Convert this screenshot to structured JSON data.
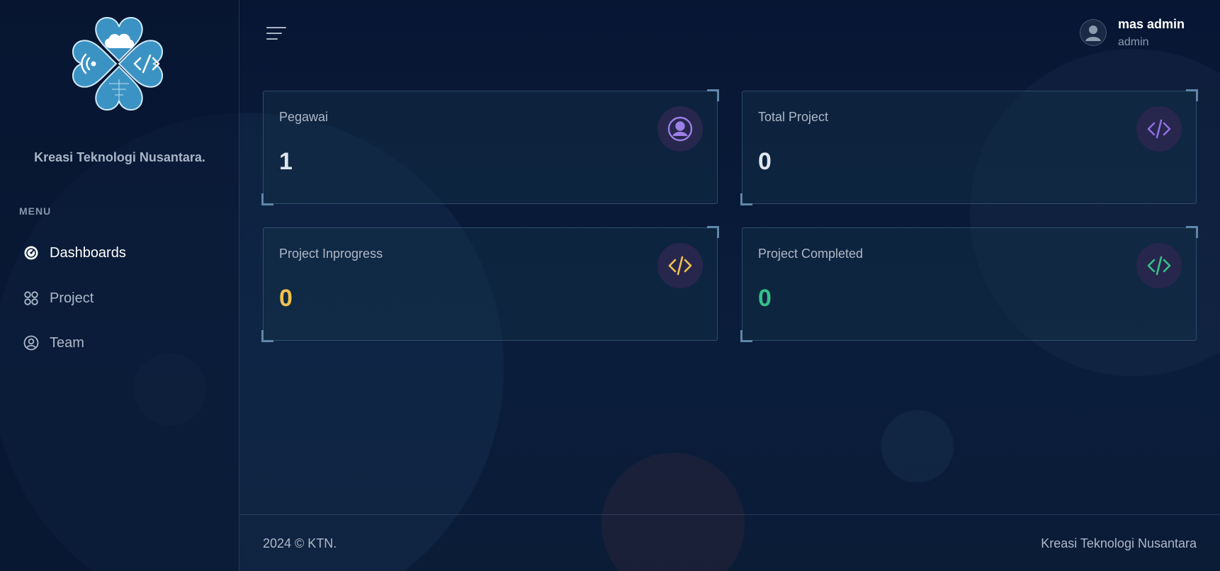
{
  "sidebar": {
    "brand": "Kreasi Teknologi Nusantara.",
    "menu_title": "MENU",
    "items": [
      {
        "label": "Dashboards",
        "icon": "dashboard-gauge-icon",
        "active": true
      },
      {
        "label": "Project",
        "icon": "grid-circles-icon",
        "active": false
      },
      {
        "label": "Team",
        "icon": "user-circle-icon",
        "active": false
      }
    ]
  },
  "header": {
    "user": {
      "name": "mas admin",
      "role": "admin"
    }
  },
  "cards": [
    {
      "label": "Pegawai",
      "value": "1",
      "value_color": "#dfe6f0",
      "icon": "user-circle-icon",
      "icon_color": "#9b7fe6"
    },
    {
      "label": "Total Project",
      "value": "0",
      "value_color": "#dfe6f0",
      "icon": "code-icon",
      "icon_color": "#8f6fe0"
    },
    {
      "label": "Project Inprogress",
      "value": "0",
      "value_color": "#f2c14e",
      "icon": "code-icon",
      "icon_color": "#f2c14e"
    },
    {
      "label": "Project Completed",
      "value": "0",
      "value_color": "#35c08a",
      "icon": "code-icon",
      "icon_color": "#35c08a"
    }
  ],
  "footer": {
    "left": "2024 © KTN.",
    "right": "Kreasi Teknologi Nusantara"
  },
  "colors": {
    "background": "#061530",
    "accent_border": "#5f86aa",
    "logo_blue": "#3b93c4"
  }
}
